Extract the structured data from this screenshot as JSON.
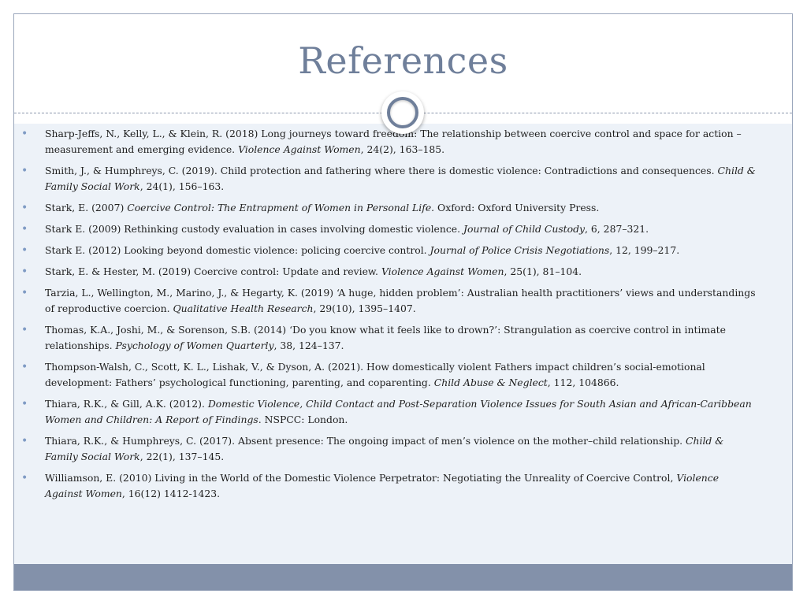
{
  "slide": {
    "title": "References",
    "colors": {
      "title": "#6f7f9a",
      "content_background": "#edf2f8",
      "footer_bar": "#8391aa",
      "bullet": "#7f9bc4"
    },
    "bullet_icon": "bullet-dot-icon",
    "bullet_glyph": "•"
  },
  "references": [
    {
      "pre": "Sharp-Jeffs, N., Kelly, L., & Klein, R. (2018) Long journeys toward freedom: The relationship between coercive control and space for action – measurement and emerging evidence. ",
      "italic": "Violence Against Women",
      "post": ", 24(2), 163–185."
    },
    {
      "pre": "Smith, J., & Humphreys, C. (2019). Child protection and fathering where there is domestic violence: Contradictions and consequences. ",
      "italic": "Child & Family Social Work",
      "post": ", 24(1), 156–163."
    },
    {
      "pre": "Stark, E. (2007) ",
      "italic": "Coercive Control: The Entrapment of Women in Personal Life.",
      "post": " Oxford: Oxford University Press."
    },
    {
      "pre": "Stark E. (2009) Rethinking custody evaluation in cases involving domestic violence. ",
      "italic": "Journal of Child Custody",
      "post": ", 6, 287–321."
    },
    {
      "pre": "Stark E. (2012) Looking beyond domestic violence: policing coercive control. ",
      "italic": "Journal of Police Crisis Negotiations",
      "post": ", 12, 199–217."
    },
    {
      "pre": "Stark, E. & Hester, M. (2019) Coercive control: Update and review. ",
      "italic": "Violence Against Women",
      "post": ", 25(1), 81–104."
    },
    {
      "pre": "Tarzia, L., Wellington, M., Marino, J., & Hegarty, K. (2019) ‘A huge, hidden problem’: Australian health practitioners’ views and understandings of reproductive coercion. ",
      "italic": "Qualitative Health Research",
      "post": ", 29(10), 1395–1407."
    },
    {
      "pre": "Thomas, K.A., Joshi, M., & Sorenson, S.B. (2014) ‘Do you know what it feels like to drown?’: Strangulation as coercive control in intimate relationships. ",
      "italic": "Psychology of Women Quarterly",
      "post": ", 38, 124–137."
    },
    {
      "pre": "Thompson-Walsh, C., Scott, K. L., Lishak, V., & Dyson, A. (2021). How domestically violent Fathers impact children’s social-emotional development: Fathers’ psychological functioning, parenting, and coparenting. ",
      "italic": "Child Abuse & Neglect",
      "post": ", 112, 104866."
    },
    {
      "pre": "Thiara, R.K., & Gill, A.K. (2012). ",
      "italic": "Domestic Violence, Child Contact and Post-Separation Violence Issues for South Asian and African-Caribbean Women and Children: A Report of Findings",
      "post": ". NSPCC: London."
    },
    {
      "pre": "Thiara, R.K., & Humphreys, C. (2017). Absent presence: The ongoing impact of men’s violence on the mother–child relationship. ",
      "italic": "Child & Family Social Work",
      "post": ", 22(1), 137–145."
    },
    {
      "pre": "Williamson, E. (2010) Living in the World of the Domestic Violence Perpetrator: Negotiating the Unreality of Coercive Control, ",
      "italic": "Violence Against Women",
      "post": ", 16(12) 1412-1423."
    }
  ]
}
